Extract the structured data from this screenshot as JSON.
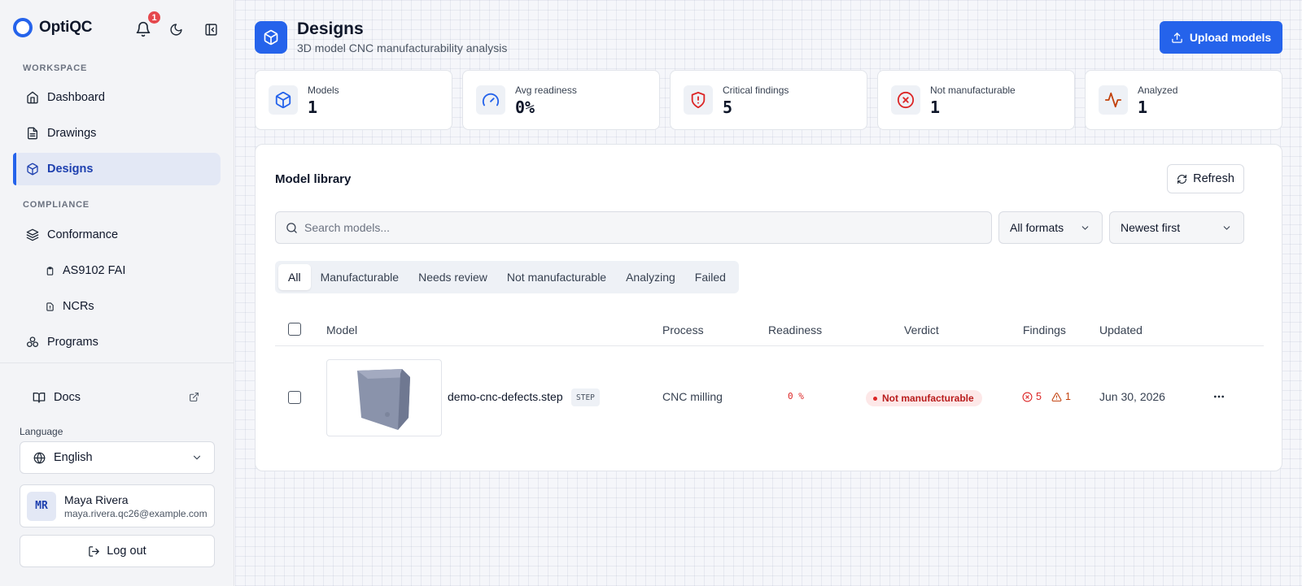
{
  "app": {
    "name": "OptiQC",
    "notification_count": "1"
  },
  "sidebar": {
    "workspace_label": "WORKSPACE",
    "compliance_label": "COMPLIANCE",
    "items": {
      "dashboard": "Dashboard",
      "drawings": "Drawings",
      "designs": "Designs",
      "conformance": "Conformance",
      "as9102": "AS9102 FAI",
      "ncrs": "NCRs",
      "programs": "Programs"
    },
    "docs": "Docs",
    "language_label": "Language",
    "language_value": "English",
    "user": {
      "initials": "MR",
      "name": "Maya Rivera",
      "email": "maya.rivera.qc26@example.com"
    },
    "logout": "Log out"
  },
  "header": {
    "title": "Designs",
    "subtitle": "3D model CNC manufacturability analysis",
    "upload_label": "Upload models"
  },
  "stats": [
    {
      "label": "Models",
      "value": "1",
      "icon": "cube-icon"
    },
    {
      "label": "Avg readiness",
      "value": "0%",
      "icon": "gauge-icon"
    },
    {
      "label": "Critical findings",
      "value": "5",
      "icon": "shield-alert-icon"
    },
    {
      "label": "Not manufacturable",
      "value": "1",
      "icon": "x-circle-icon"
    },
    {
      "label": "Analyzed",
      "value": "1",
      "icon": "activity-icon"
    }
  ],
  "library": {
    "title": "Model library",
    "refresh_label": "Refresh",
    "search_placeholder": "Search models...",
    "format_filter": "All formats",
    "sort": "Newest first",
    "tabs": [
      "All",
      "Manufacturable",
      "Needs review",
      "Not manufacturable",
      "Analyzing",
      "Failed"
    ],
    "columns": {
      "model": "Model",
      "process": "Process",
      "readiness": "Readiness",
      "verdict": "Verdict",
      "findings": "Findings",
      "updated": "Updated"
    },
    "rows": [
      {
        "filename": "demo-cnc-defects.step",
        "format": "STEP",
        "process": "CNC milling",
        "readiness": "0 %",
        "verdict": "Not manufacturable",
        "critical": "5",
        "warnings": "1",
        "updated": "Jun 30, 2026"
      }
    ]
  },
  "colors": {
    "accent": "#2563eb",
    "danger": "#dc2626",
    "warning": "#c2410c"
  }
}
